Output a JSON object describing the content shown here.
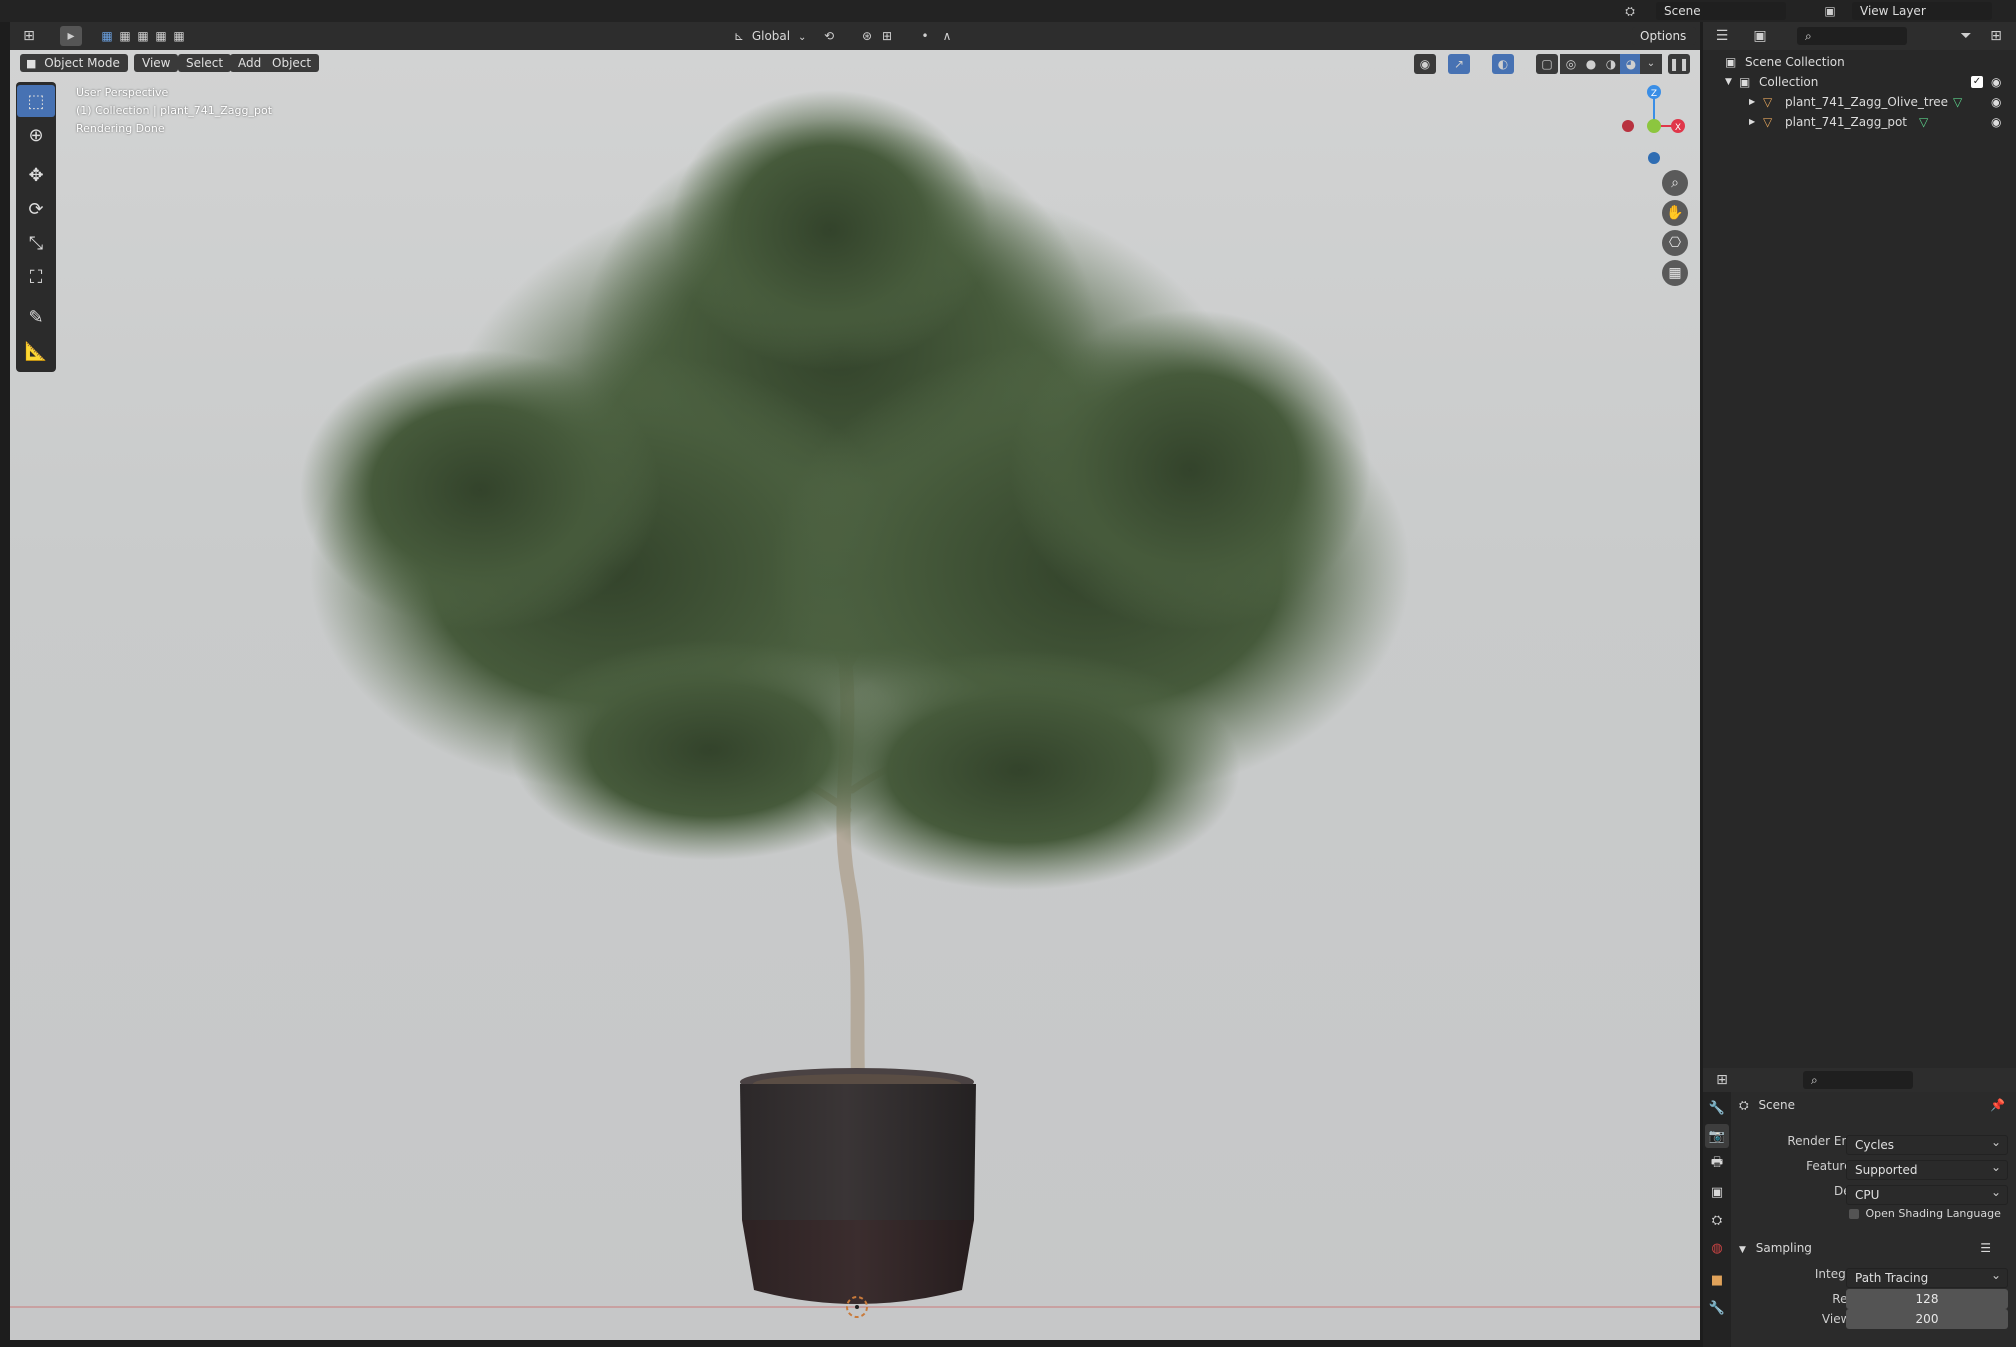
{
  "topbar": {
    "scene_name": "Scene",
    "view_layer": "View Layer"
  },
  "viewport_header": {
    "mode": "Object Mode",
    "menus": [
      "View",
      "Select",
      "Add",
      "Object"
    ],
    "transform_orientation": "Global",
    "options_label": "Options"
  },
  "viewport": {
    "overlay_lines": [
      "User Perspective",
      "(1) Collection | plant_741_Zagg_pot",
      "Rendering Done"
    ],
    "gizmo_axes": {
      "z": "Z",
      "x": "X"
    },
    "colors": {
      "background": "#cbcdcd",
      "x_axis": "#e0374a",
      "y_axis": "#8cc63f",
      "z_axis": "#3a8ee6"
    }
  },
  "outliner": {
    "root": "Scene Collection",
    "collection": "Collection",
    "items": [
      {
        "name": "plant_741_Zagg_Olive_tree"
      },
      {
        "name": "plant_741_Zagg_pot"
      }
    ]
  },
  "properties": {
    "context": "Scene",
    "render_engine_label": "Render Engine",
    "render_engine": "Cycles",
    "feature_set_label": "Feature Set",
    "feature_set": "Supported",
    "device_label": "Device",
    "device": "CPU",
    "osl_label": "Open Shading Language",
    "sampling": {
      "title": "Sampling",
      "integrator_label": "Integrator",
      "integrator": "Path Tracing",
      "render_label": "Render",
      "render_samples": "128",
      "viewport_label": "Viewport",
      "viewport_samples": "200"
    }
  },
  "icons": {
    "editor_type": "3d-viewport-icon",
    "tools": [
      "select-box-icon",
      "cursor-icon",
      "move-icon",
      "rotate-icon",
      "scale-icon",
      "transform-icon",
      "annotate-icon",
      "measure-icon"
    ],
    "nav": [
      "zoom-icon",
      "hand-pan-icon",
      "camera-icon",
      "grid-ortho-icon"
    ]
  }
}
